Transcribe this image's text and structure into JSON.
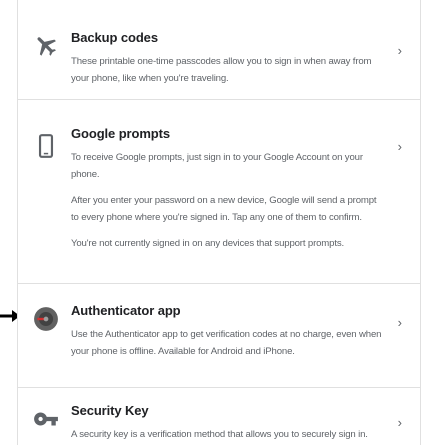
{
  "methods": [
    {
      "title": "Backup codes",
      "icon": "airplane-icon",
      "descriptions": [
        "These printable one-time passcodes allow you to sign in when away from your phone, like when you're traveling."
      ]
    },
    {
      "title": "Google prompts",
      "icon": "phone-icon",
      "descriptions": [
        "To receive Google prompts, just sign in to your Google Account on your phone.",
        "After you enter your password on a new device, Google will send a prompt to every phone where you're signed in. Tap any one of them to confirm.",
        "You're not currently signed in on any devices that support prompts."
      ]
    },
    {
      "title": "Authenticator app",
      "icon": "authenticator-icon",
      "descriptions": [
        "Use the Authenticator app to get verification codes at no charge, even when your phone is offline. Available for Android and iPhone."
      ]
    },
    {
      "title": "Security Key",
      "icon": "key-icon",
      "descriptions": [
        "A security key is a verification method that allows you to securely sign in. These"
      ]
    }
  ],
  "chevron_glyph": "›",
  "colors": {
    "icon": "#5f6368",
    "authenticator_dark": "#616161",
    "authenticator_accent": "#d32f2f",
    "pointer": "#000000"
  }
}
